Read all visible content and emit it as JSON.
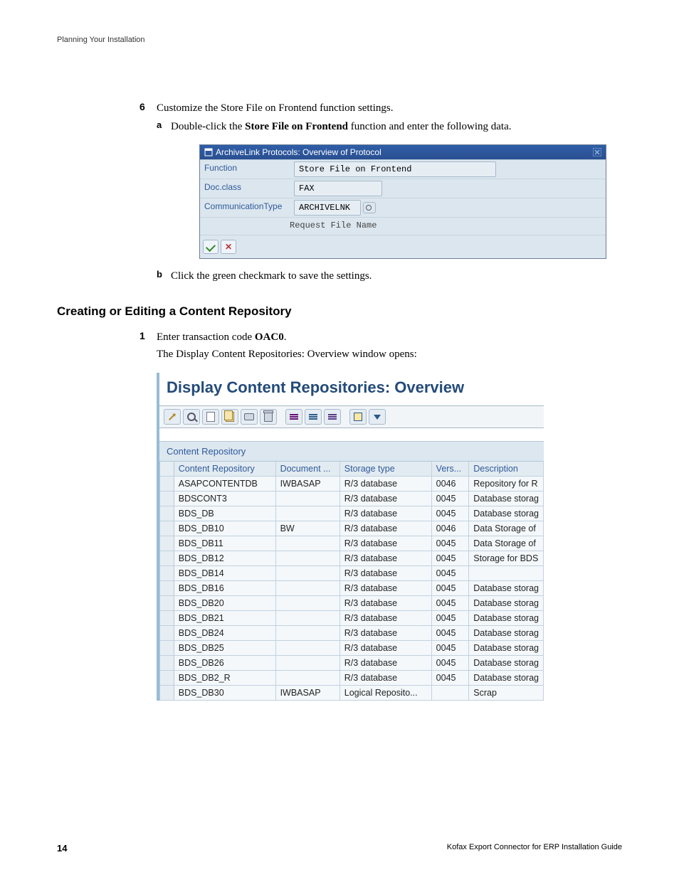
{
  "running_header": "Planning Your Installation",
  "step6": {
    "num": "6",
    "text": "Customize the Store File on Frontend function settings.",
    "a_letter": "a",
    "a_text_1": "Double-click the ",
    "a_bold": "Store File on Frontend",
    "a_text_2": " function and enter the following data.",
    "b_letter": "b",
    "b_text": "Click the green checkmark to save the settings."
  },
  "dlg": {
    "title": "ArchiveLink Protocols: Overview of Protocol",
    "rows": {
      "function_label": "Function",
      "function_value": "Store File on Frontend",
      "docclass_label": "Doc.class",
      "docclass_value": "FAX",
      "commtype_label": "CommunicationType",
      "commtype_value": "ARCHIVELNK",
      "request_label": "Request File Name"
    }
  },
  "h3": "Creating or Editing a Content Repository",
  "step1": {
    "num": "1",
    "text_1": "Enter transaction code ",
    "bold": "OAC0",
    "text_2": ".",
    "line2": "The Display Content Repositories: Overview window opens:"
  },
  "ov": {
    "title": "Display Content Repositories: Overview",
    "section": "Content Repository",
    "headers": {
      "repo": "Content Repository",
      "doc": "Document ...",
      "stor": "Storage type",
      "vers": "Vers...",
      "desc": "Description"
    },
    "rows": [
      {
        "repo": "ASAPCONTENTDB",
        "doc": "IWBASAP",
        "stor": "R/3 database",
        "vers": "0046",
        "desc": "Repository for R"
      },
      {
        "repo": "BDSCONT3",
        "doc": "",
        "stor": "R/3 database",
        "vers": "0045",
        "desc": "Database storag"
      },
      {
        "repo": "BDS_DB",
        "doc": "",
        "stor": "R/3 database",
        "vers": "0045",
        "desc": "Database storag"
      },
      {
        "repo": "BDS_DB10",
        "doc": "BW",
        "stor": "R/3 database",
        "vers": "0046",
        "desc": "Data Storage of"
      },
      {
        "repo": "BDS_DB11",
        "doc": "",
        "stor": "R/3 database",
        "vers": "0045",
        "desc": "Data Storage of"
      },
      {
        "repo": "BDS_DB12",
        "doc": "",
        "stor": "R/3 database",
        "vers": "0045",
        "desc": "Storage for BDS"
      },
      {
        "repo": "BDS_DB14",
        "doc": "",
        "stor": "R/3 database",
        "vers": "0045",
        "desc": ""
      },
      {
        "repo": "BDS_DB16",
        "doc": "",
        "stor": "R/3 database",
        "vers": "0045",
        "desc": "Database storag"
      },
      {
        "repo": "BDS_DB20",
        "doc": "",
        "stor": "R/3 database",
        "vers": "0045",
        "desc": "Database storag"
      },
      {
        "repo": "BDS_DB21",
        "doc": "",
        "stor": "R/3 database",
        "vers": "0045",
        "desc": "Database storag"
      },
      {
        "repo": "BDS_DB24",
        "doc": "",
        "stor": "R/3 database",
        "vers": "0045",
        "desc": "Database storag"
      },
      {
        "repo": "BDS_DB25",
        "doc": "",
        "stor": "R/3 database",
        "vers": "0045",
        "desc": "Database storag"
      },
      {
        "repo": "BDS_DB26",
        "doc": "",
        "stor": "R/3 database",
        "vers": "0045",
        "desc": "Database storag"
      },
      {
        "repo": "BDS_DB2_R",
        "doc": "",
        "stor": "R/3 database",
        "vers": "0045",
        "desc": "Database storag"
      },
      {
        "repo": "BDS_DB30",
        "doc": "IWBASAP",
        "stor": "Logical Reposito...",
        "vers": "",
        "desc": "Scrap"
      }
    ]
  },
  "footer": {
    "page": "14",
    "doc_title": "Kofax Export Connector for ERP Installation Guide"
  }
}
